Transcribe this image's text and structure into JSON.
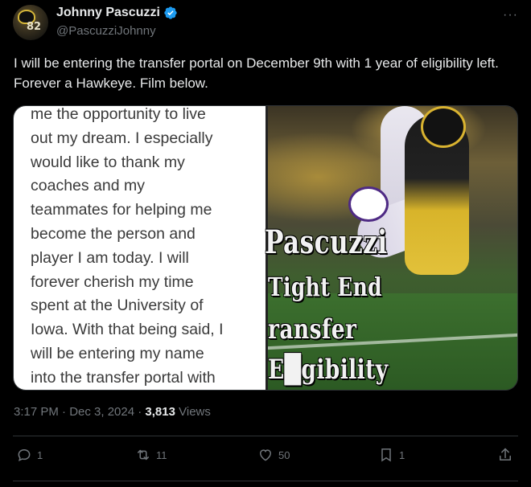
{
  "author": {
    "display_name": "Johnny Pascuzzi",
    "handle": "@PascuzziJohnny",
    "avatar_number": "82",
    "verified": true
  },
  "tweet": {
    "text": "I will be entering the transfer portal on December 9th with 1 year of eligibility left. Forever a Hawkeye. Film below.",
    "more_icon": "···"
  },
  "media": {
    "note_text": "me the opportunity to live\nout my dream. I especially\nwould like to thank my\ncoaches and my\nteammates for helping me\nbecome the person and\nplayer I am today. I will\nforever cherish my time\nspent at the University of\nIowa. With that being said, I\nwill be entering my name\ninto the transfer portal with",
    "overlay_lines": [
      "Pascuzzi",
      "Tight End",
      "ransfer",
      "E█gibility"
    ]
  },
  "meta": {
    "time_date": "3:17 PM · Dec 3, 2024 · ",
    "views_count": "3,813",
    "views_label": " Views"
  },
  "actions": {
    "reply_count": "1",
    "retweet_count": "11",
    "like_count": "50",
    "bookmark_count": "1"
  },
  "colors": {
    "background": "#000000",
    "text": "#e7e9ea",
    "muted": "#71767b",
    "verified": "#1d9bf0",
    "divider": "#2f3336"
  }
}
